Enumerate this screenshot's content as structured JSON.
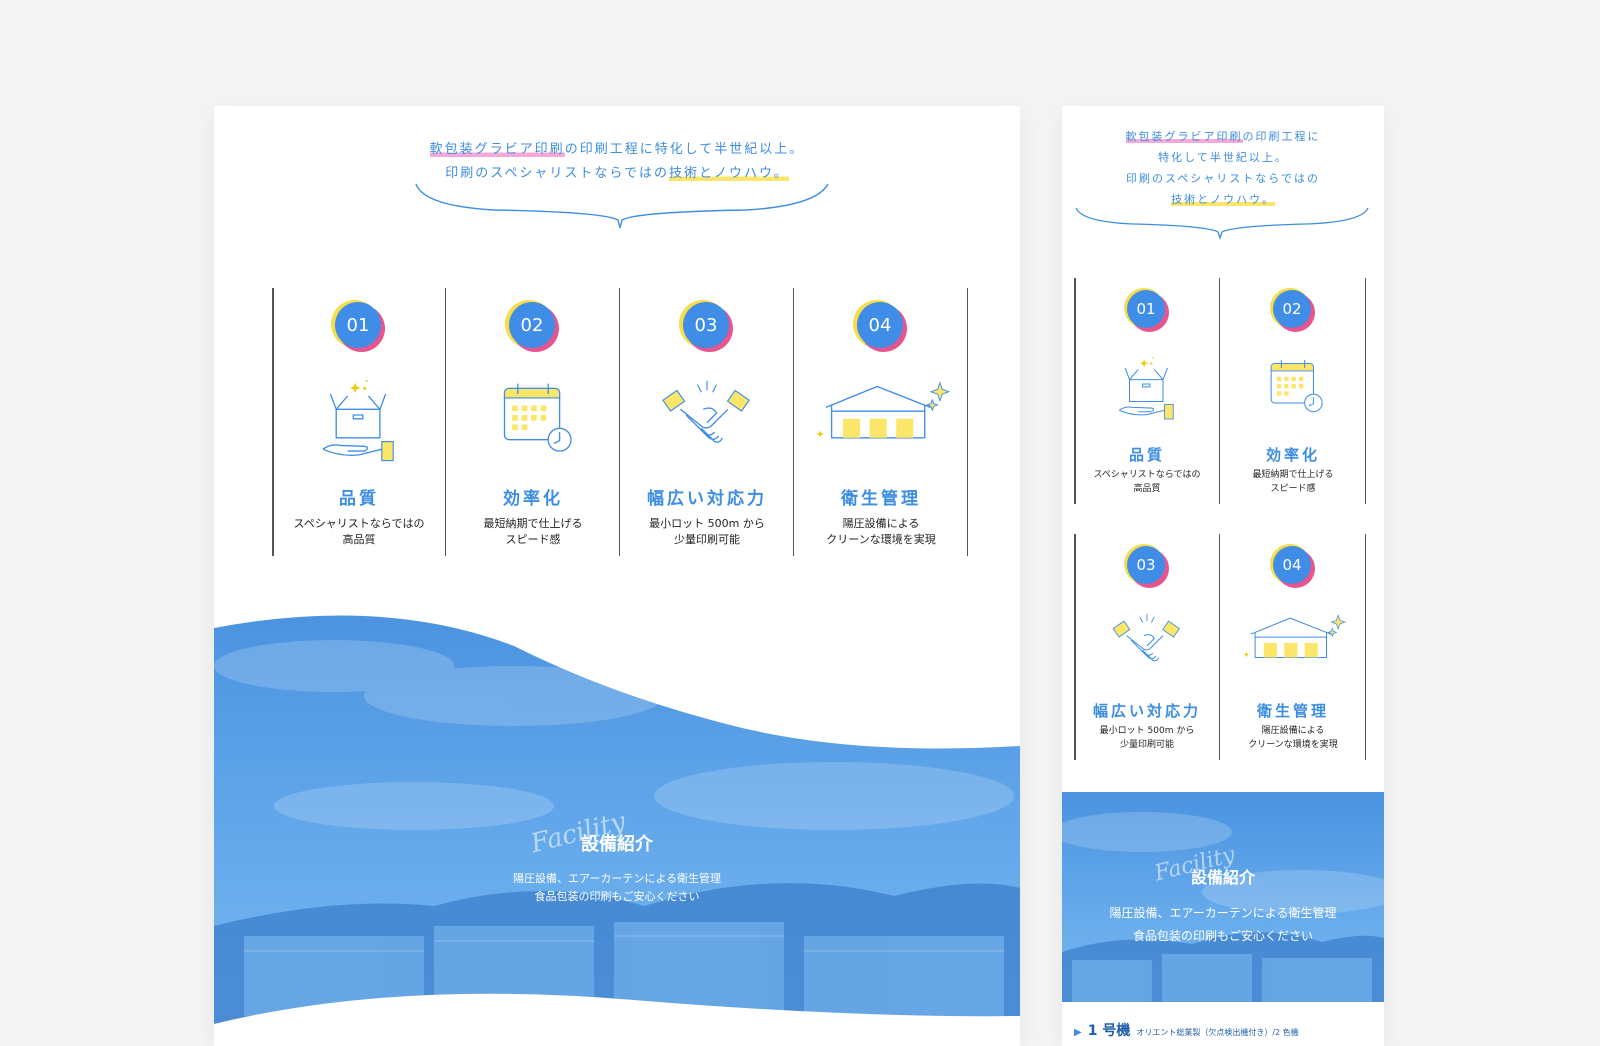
{
  "intro": {
    "p1": "軟包装グラビア印刷",
    "p2": "の印刷工程に特化して半世紀以上。",
    "p3": "印刷のスペシャリストならではの",
    "p4": "技術とノウハウ。",
    "mobile_p2a": "の印刷工程に",
    "mobile_p2b": "特化して半世紀以上。"
  },
  "features": [
    {
      "num": "01",
      "title": "品質",
      "desc": "スペシャリストならではの\n高品質",
      "icon": "box-hand-icon"
    },
    {
      "num": "02",
      "title": "効率化",
      "desc": "最短納期で仕上げる\nスピード感",
      "icon": "calendar-clock-icon"
    },
    {
      "num": "03",
      "title": "幅広い対応力",
      "desc": "最小ロット 500m から\n少量印刷可能",
      "icon": "handshake-icon"
    },
    {
      "num": "04",
      "title": "衛生管理",
      "desc": "陽圧設備によるクリーンな環境を実現",
      "desc_lines": "陽圧設備による\nクリーンな環境を実現",
      "icon": "factory-sparkle-icon"
    }
  ],
  "facility": {
    "script": "Facility",
    "title": "設備紹介",
    "desc": "陽圧設備、エアーカーテンによる衛生管理\n食品包装の印刷もご安心ください"
  },
  "machine": {
    "name": "1 号機",
    "desc": "オリエント総業製（欠点検出機付き）/2 色機"
  },
  "colors": {
    "accent": "#3d8de0",
    "badge_blue": "#3f8de6",
    "badge_yellow": "#f7dd4a",
    "badge_pink": "#e6558f",
    "icon_fill": "#fbe66a"
  }
}
